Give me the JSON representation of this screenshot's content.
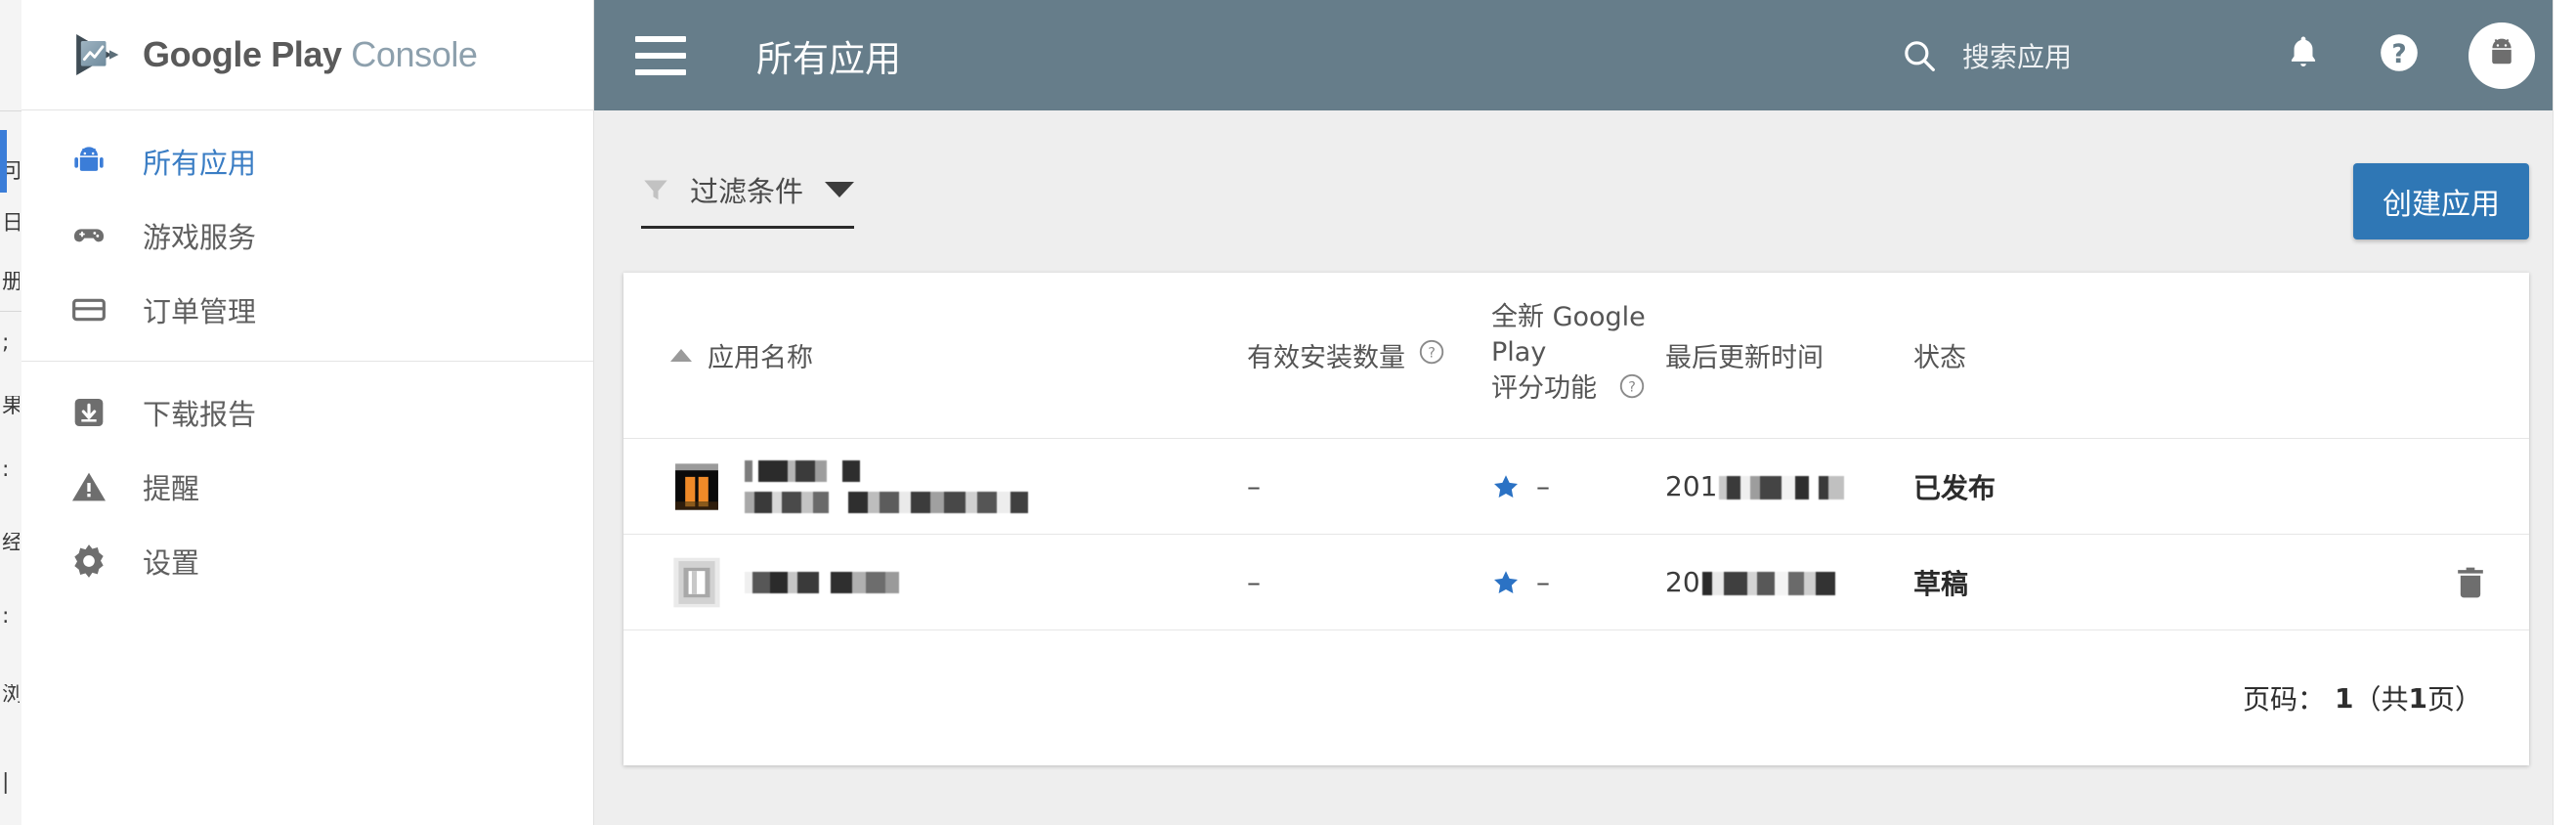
{
  "brand": {
    "name_bold": "Google Play",
    "name_light": "Console",
    "logo_icon": "play-console-logo-icon"
  },
  "sidebar": {
    "items": [
      {
        "label": "所有应用",
        "icon": "android-robot-icon",
        "active": true
      },
      {
        "label": "游戏服务",
        "icon": "gamepad-icon",
        "active": false
      },
      {
        "label": "订单管理",
        "icon": "credit-card-icon",
        "active": false
      },
      {
        "label": "下载报告",
        "icon": "download-box-icon",
        "active": false
      },
      {
        "label": "提醒",
        "icon": "warning-triangle-icon",
        "active": false
      },
      {
        "label": "设置",
        "icon": "gear-icon",
        "active": false
      }
    ]
  },
  "appbar": {
    "menu_icon": "hamburger-menu-icon",
    "title": "所有应用",
    "search": {
      "icon": "search-icon",
      "placeholder": "搜索应用",
      "value": ""
    },
    "notifications_icon": "bell-icon",
    "help_icon": "question-mark-icon",
    "avatar_icon": "android-avatar-icon"
  },
  "toolbar": {
    "filter_icon": "funnel-icon",
    "filter_label": "过滤条件",
    "filter_caret_icon": "chevron-down-icon",
    "create_label": "创建应用"
  },
  "table": {
    "columns": [
      {
        "key": "name",
        "label": "应用名称",
        "sorted": true,
        "sort_dir": "asc",
        "help": false
      },
      {
        "key": "installs",
        "label": "有效安装数量",
        "sorted": false,
        "help": true
      },
      {
        "key": "rating",
        "label_line1": "全新 Google Play",
        "label_line2": "评分功能",
        "sorted": false,
        "help": true
      },
      {
        "key": "updated",
        "label": "最后更新时间",
        "sorted": false,
        "help": false
      },
      {
        "key": "status",
        "label": "状态",
        "sorted": false,
        "help": false
      },
      {
        "key": "actions",
        "label": "",
        "sorted": false,
        "help": false
      }
    ],
    "rows": [
      {
        "icon": "app-icon-orange-bars",
        "name_line1": "[已屏蔽]",
        "name_line2": "[已屏蔽]",
        "name_redacted": true,
        "installs": "–",
        "rating_star_icon": "star-icon",
        "rating": "–",
        "updated_prefix": "201",
        "updated_redacted": true,
        "status": "已发布",
        "has_delete": false
      },
      {
        "icon": "app-icon-gray-frame",
        "name_line1": "[已屏蔽]",
        "name_line2": "",
        "name_redacted": true,
        "installs": "–",
        "rating_star_icon": "star-icon",
        "rating": "–",
        "updated_prefix": "20",
        "updated_redacted": true,
        "status": "草稿",
        "has_delete": true,
        "delete_icon": "trash-icon"
      }
    ],
    "pager": {
      "label": "页码：",
      "current": "1",
      "open_paren": "（共 ",
      "total": "1",
      "close_paren": " 页）"
    }
  },
  "colors": {
    "appbar_bg": "#667d8a",
    "content_bg": "#eeeeee",
    "accent_blue": "#3b7dd8",
    "create_button": "#2f77b5",
    "star_blue": "#2b72c4",
    "nav_text": "#5f5f5f",
    "active_nav_text": "#3a7dc4"
  }
}
